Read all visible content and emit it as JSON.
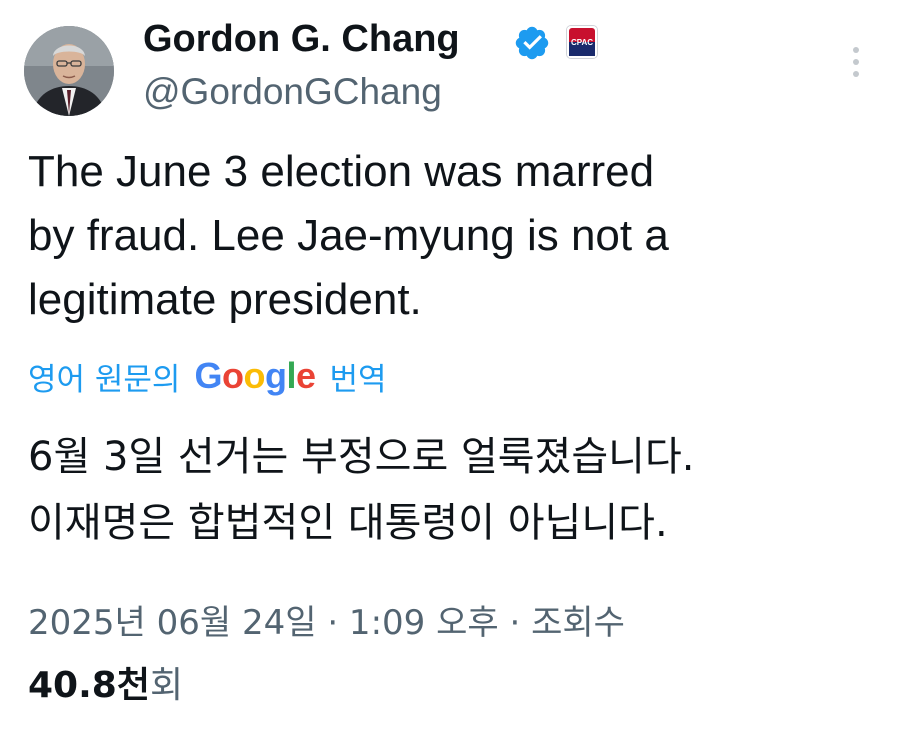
{
  "author": {
    "display_name": "Gordon G. Chang",
    "handle": "@GordonGChang",
    "verified_icon": "verified-badge-icon",
    "affiliate_badge_text": "CPAC",
    "avatar": "profile-photo"
  },
  "tweet": {
    "text_lines": [
      "The June 3 election was marred",
      "by fraud. Lee Jae-myung is not a",
      "legitimate president."
    ],
    "translation_label_prefix": "영어 원문의",
    "translation_label_suffix": "번역",
    "translation_provider": "Google",
    "translated_lines": [
      "6월 3일 선거는 부정으로 얼룩졌습니다.",
      "이재명은 합법적인 대통령이 아닙니다."
    ],
    "meta_line": "2025년 06월 24일 · 1:09 오후 · 조회수",
    "views_count": "40.8천",
    "views_unit": "회"
  },
  "colors": {
    "text": "#0f1419",
    "secondary": "#536471",
    "link": "#1d9bf0",
    "verified": "#1d9bf0"
  }
}
